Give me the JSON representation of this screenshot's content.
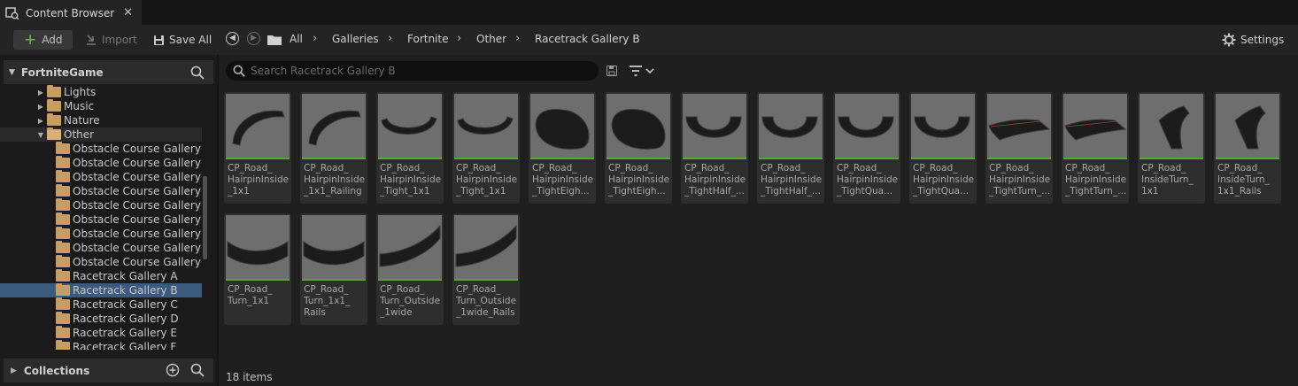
{
  "tab": {
    "title": "Content Browser",
    "close": "✕"
  },
  "toolbar": {
    "add_label": "Add",
    "import_label": "Import",
    "save_all_label": "Save All",
    "settings_label": "Settings"
  },
  "breadcrumb": [
    "All",
    "Galleries",
    "Fortnite",
    "Other",
    "Racetrack Gallery B"
  ],
  "sources": {
    "root_label": "FortniteGame",
    "tree": [
      {
        "label": "Lights",
        "arrow": "▶",
        "indent": 1
      },
      {
        "label": "Music",
        "arrow": "▶",
        "indent": 1
      },
      {
        "label": "Nature",
        "arrow": "▶",
        "indent": 1
      },
      {
        "label": "Other",
        "arrow": "▼",
        "indent": 1,
        "expanded": true
      },
      {
        "label": "Obstacle Course Gallery",
        "indent": 2
      },
      {
        "label": "Obstacle Course Gallery",
        "indent": 2
      },
      {
        "label": "Obstacle Course Gallery",
        "indent": 2
      },
      {
        "label": "Obstacle Course Gallery",
        "indent": 2
      },
      {
        "label": "Obstacle Course Gallery",
        "indent": 2
      },
      {
        "label": "Obstacle Course Gallery",
        "indent": 2
      },
      {
        "label": "Obstacle Course Gallery",
        "indent": 2
      },
      {
        "label": "Obstacle Course Gallery",
        "indent": 2
      },
      {
        "label": "Obstacle Course Gallery",
        "indent": 2
      },
      {
        "label": "Racetrack Gallery A",
        "indent": 2
      },
      {
        "label": "Racetrack Gallery B",
        "indent": 2,
        "selected": true
      },
      {
        "label": "Racetrack Gallery C",
        "indent": 2
      },
      {
        "label": "Racetrack Gallery D",
        "indent": 2
      },
      {
        "label": "Racetrack Gallery E",
        "indent": 2
      },
      {
        "label": "Racetrack Gallery F",
        "indent": 2
      }
    ],
    "collections_label": "Collections"
  },
  "search": {
    "placeholder": "Search Racetrack Gallery B"
  },
  "assets": [
    {
      "name": "CP_Road_\nHairpinInside\n_1x1",
      "shape": "arc"
    },
    {
      "name": "CP_Road_\nHairpinInside\n_1x1_Railing",
      "shape": "arc"
    },
    {
      "name": "CP_Road_\nHairpinInside\n_Tight_1x1",
      "shape": "u-flat"
    },
    {
      "name": "CP_Road_\nHairpinInside\n_Tight_1x1_...",
      "shape": "u-flat"
    },
    {
      "name": "CP_Road_\nHairpinInside\n_TightEigh...",
      "shape": "dome"
    },
    {
      "name": "CP_Road_\nHairpinInside\n_TightEigh...",
      "shape": "dome"
    },
    {
      "name": "CP_Road_\nHairpinInside\n_TightHalf_...",
      "shape": "u-deep"
    },
    {
      "name": "CP_Road_\nHairpinInside\n_TightHalf_...",
      "shape": "u-deep"
    },
    {
      "name": "CP_Road_\nHairpinInside\n_TightQua...",
      "shape": "u-deep"
    },
    {
      "name": "CP_Road_\nHairpinInside\n_TightQua...",
      "shape": "u-deep"
    },
    {
      "name": "CP_Road_\nHairpinInside\n_TightTurn_...",
      "shape": "wedge"
    },
    {
      "name": "CP_Road_\nHairpinInside\n_TightTurn_...",
      "shape": "wedge"
    },
    {
      "name": "CP_Road_\nInsideTurn_\n1x1",
      "shape": "curve"
    },
    {
      "name": "CP_Road_\nInsideTurn_\n1x1_Rails",
      "shape": "curve"
    },
    {
      "name": "CP_Road_\nTurn_1x1",
      "shape": "fan"
    },
    {
      "name": "CP_Road_\nTurn_1x1_\nRails",
      "shape": "fan"
    },
    {
      "name": "CP_Road_\nTurn_Outside\n_1wide",
      "shape": "band"
    },
    {
      "name": "CP_Road_\nTurn_Outside\n_1wide_Rails",
      "shape": "band"
    }
  ],
  "status": {
    "items_count": "18 items"
  },
  "colors": {
    "accent_selected": "#3b5a7d",
    "folder": "#c79d62",
    "asset_type_bar": "#5aa63c"
  }
}
